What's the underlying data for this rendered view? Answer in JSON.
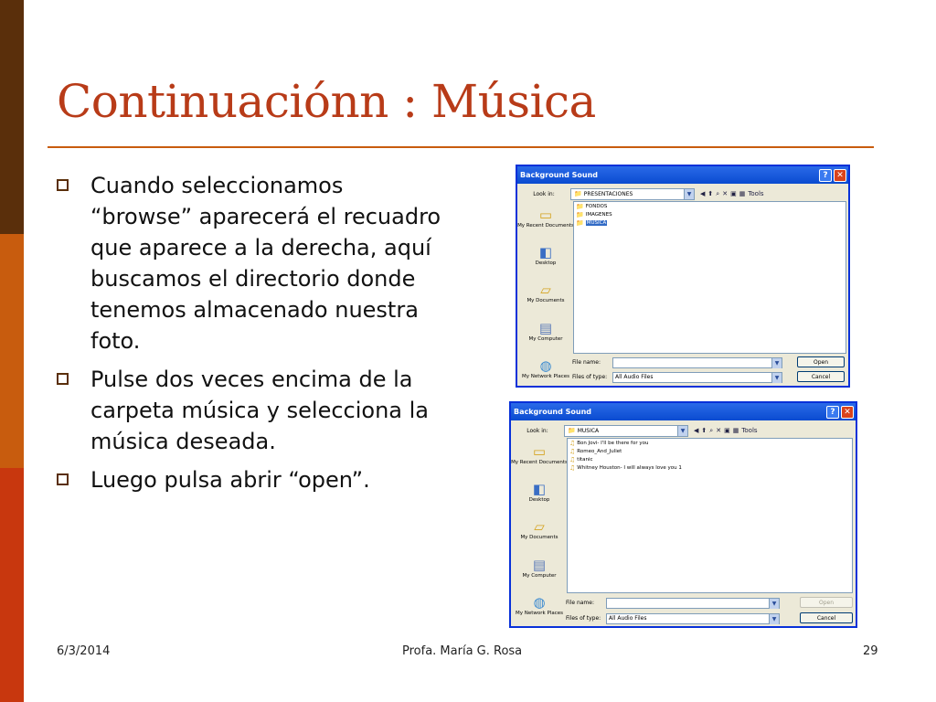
{
  "slide": {
    "title": "Continuaciónn :  Música",
    "bullets": [
      "Cuando seleccionamos “browse” aparecerá el recuadro que aparece a la derecha, aquí buscamos el directorio donde tenemos almacenado nuestra foto.",
      "Pulse dos veces encima de la carpeta música y selecciona la música deseada.",
      "Luego pulsa abrir “open”."
    ],
    "footer": {
      "date": "6/3/2014",
      "author": "Profa. María G. Rosa",
      "page": "29"
    }
  },
  "dialog1": {
    "title": "Background Sound",
    "help": "?",
    "close": "✕",
    "look_in_label": "Look in:",
    "look_in_value": "PRESENTACIONES",
    "tools_label": "Tools",
    "places": [
      "My Recent Documents",
      "Desktop",
      "My Documents",
      "My Computer",
      "My Network Places"
    ],
    "files": [
      "FONDOS",
      "IMAGENES",
      "MUSICA"
    ],
    "selected_file": "MUSICA",
    "file_name_label": "File name:",
    "file_name_value": "",
    "files_of_type_label": "Files of type:",
    "files_of_type_value": "All Audio Files",
    "open_label": "Open",
    "cancel_label": "Cancel"
  },
  "dialog2": {
    "title": "Background Sound",
    "help": "?",
    "close": "✕",
    "look_in_label": "Look in:",
    "look_in_value": "MUSICA",
    "tools_label": "Tools",
    "places": [
      "My Recent Documents",
      "Desktop",
      "My Documents",
      "My Computer",
      "My Network Places"
    ],
    "files": [
      "Bon Jovi- I'll be there for you",
      "Romeo_And_Juliet",
      "titanic",
      "Whitney Houston- I will always love you 1"
    ],
    "file_name_label": "File name:",
    "file_name_value": "",
    "files_of_type_label": "Files of type:",
    "files_of_type_value": "All Audio Files",
    "open_label": "Open",
    "cancel_label": "Cancel"
  },
  "colors": {
    "title": "#b83b18",
    "stripe_top": "#5a2f0b",
    "stripe_mid": "#c85c0e",
    "stripe_bottom": "#c8370e",
    "xp_title": "#0a4bd0"
  }
}
